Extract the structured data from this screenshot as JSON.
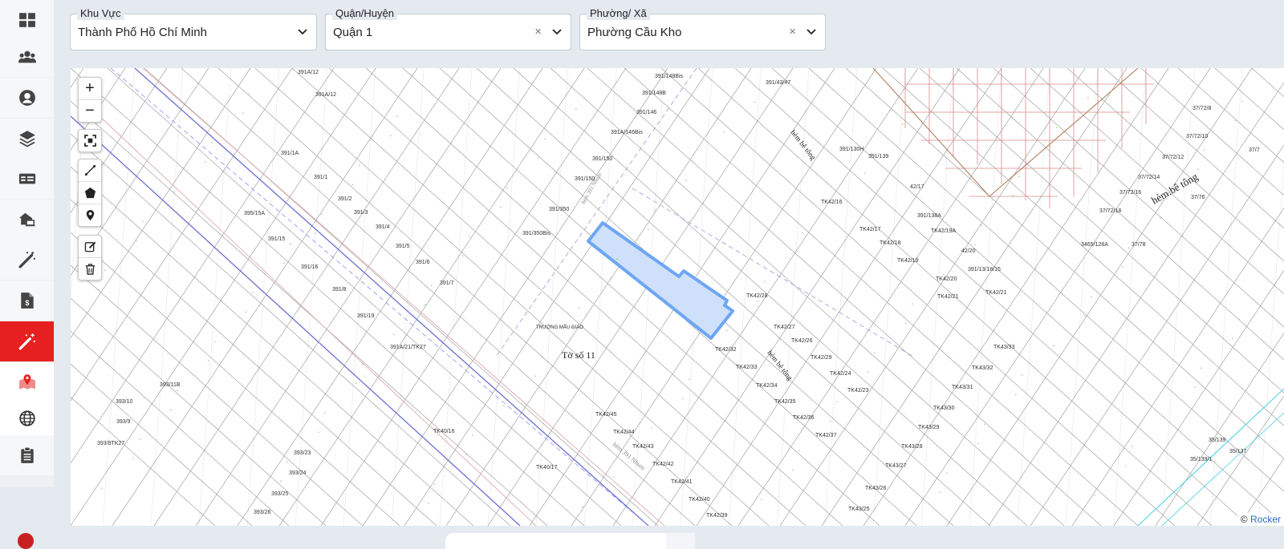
{
  "sidebar": {
    "items": [
      {
        "icon": "dashboard-icon",
        "active": false
      },
      {
        "icon": "users-icon",
        "active": false
      },
      {
        "icon": "user-circle-icon",
        "active": false
      },
      {
        "icon": "layers-icon",
        "active": false
      },
      {
        "icon": "id-card-icon",
        "active": false
      },
      {
        "icon": "house-laptop-icon",
        "active": false
      },
      {
        "icon": "magic-wand-icon",
        "active": false
      },
      {
        "icon": "file-invoice-dollar-icon",
        "active": false
      },
      {
        "icon": "magic-wand-sparkles-icon",
        "active": true
      },
      {
        "icon": "map-location-icon",
        "active": false
      },
      {
        "icon": "globe-icon",
        "active": false
      },
      {
        "icon": "clipboard-list-icon",
        "active": false
      }
    ],
    "accent_color": "#e62020"
  },
  "filters": {
    "region": {
      "label": "Khu Vực",
      "value": "Thành Phố Hồ Chí Minh"
    },
    "district": {
      "label": "Quận/Huyện",
      "value": "Quận 1",
      "clear": "×"
    },
    "ward": {
      "label": "Phường/ Xã",
      "value": "Phường Cầu Kho",
      "clear": "×"
    }
  },
  "map": {
    "controls": {
      "zoom_in": "+",
      "zoom_out": "−"
    },
    "attribution": {
      "symbol": "©",
      "link": "Rocker"
    },
    "highlight_color": "#5b9bf0",
    "sheet_label": "Tờ số 11",
    "school_label": "TRƯỜNG MẪU GIÁO",
    "street_labels": [
      "hẻm.bê tông",
      "hẻm bê tông",
      "hẻm bê tông",
      "hẻm 391 Nhum",
      "hẻm 391 Nhum"
    ],
    "parcel_labels": [
      "391A/12",
      "391A/12",
      "391/1A",
      "391/1",
      "391/2",
      "391/3",
      "391/4",
      "391/5",
      "391/6",
      "391/7",
      "395/15A",
      "391/15",
      "391/16",
      "391/8",
      "391/19",
      "391A/21/TK27",
      "393/11B",
      "393/10",
      "393/9",
      "393/8TK27",
      "393/23",
      "393/24",
      "393/25",
      "393/26",
      "391/148Bis",
      "391/148B",
      "391/146",
      "391A/146Bis",
      "391/150",
      "391/150",
      "391/350",
      "391/350Bis",
      "391/43/47",
      "391/130H",
      "391/139",
      "42/17",
      "391/138A",
      "42/20",
      "391/13/18/15",
      "TK42/16",
      "TK42/17",
      "TK42/18",
      "TK42/19",
      "TK42/19A",
      "TK42/20",
      "TK42/21",
      "TK42/21",
      "TK42/26",
      "TK42/27",
      "TK42/28",
      "TK42/29",
      "TK42/24",
      "TK42/23",
      "TK42/32",
      "TK42/33",
      "TK42/34",
      "TK42/35",
      "TK42/36",
      "TK42/37",
      "TK42/45",
      "TK42/44",
      "TK42/43",
      "TK42/42",
      "TK42/41",
      "TK42/40",
      "TK42/39",
      "TK40/16",
      "TK40/17",
      "TK43/33",
      "TK43/32",
      "TK43/31",
      "TK43/30",
      "TK43/29",
      "TK43/28",
      "TK43/27",
      "TK43/26",
      "TK43/25",
      "37/72/8",
      "37/72/10",
      "37/72/12",
      "37/72/14",
      "37/72/16",
      "37/72/18",
      "37/76",
      "37/78",
      "3465/128A",
      "37/7",
      "35/139",
      "35/137",
      "35/139/1"
    ]
  }
}
